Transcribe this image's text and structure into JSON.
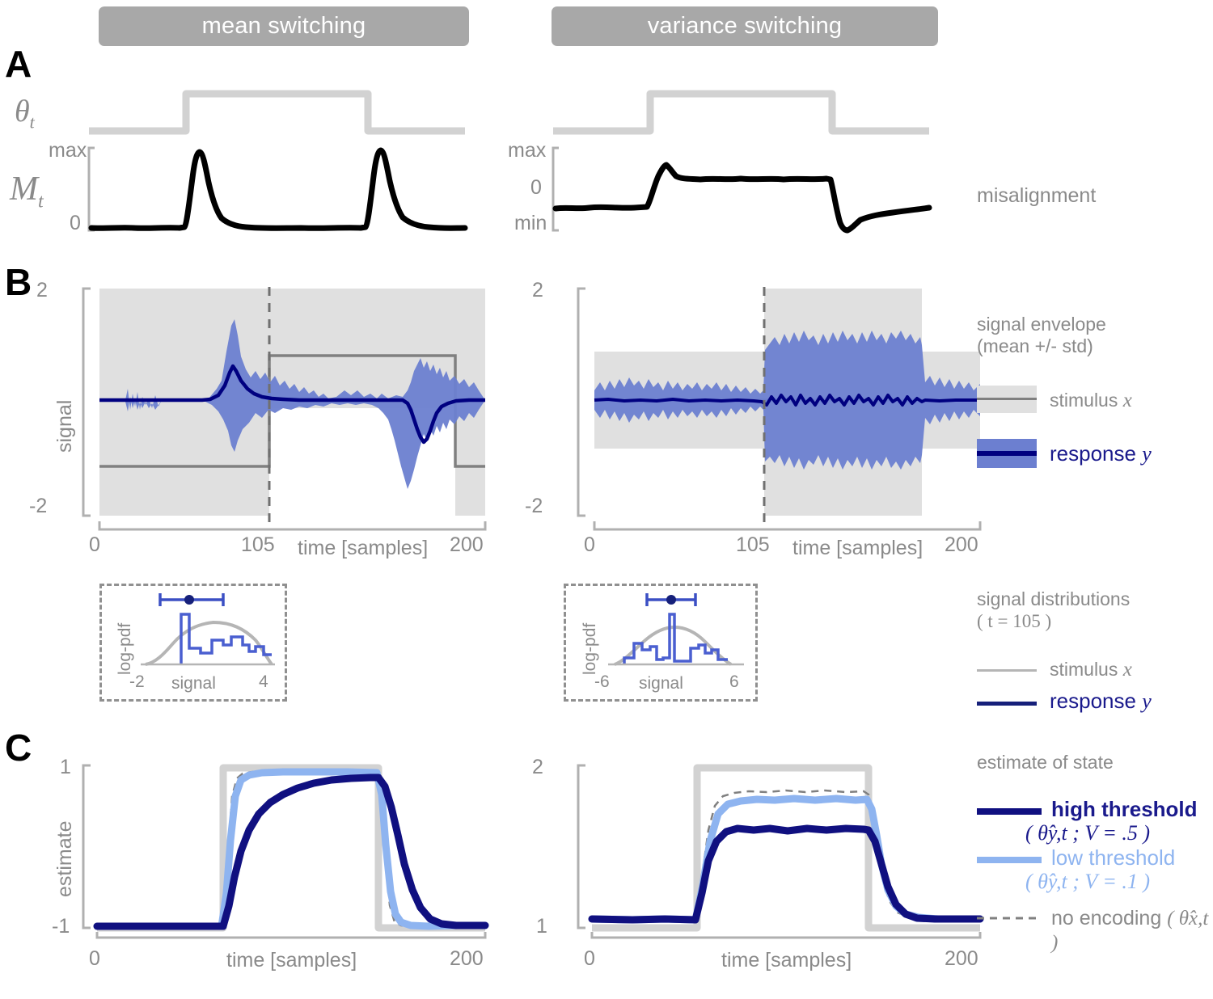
{
  "figure": {
    "columns": [
      {
        "id": "mean",
        "title": "mean switching"
      },
      {
        "id": "variance",
        "title": "variance switching"
      }
    ],
    "panels": [
      {
        "letter": "A"
      },
      {
        "letter": "B"
      },
      {
        "letter": "C"
      }
    ]
  },
  "panelA": {
    "state_label": "θ",
    "state_sub": "t",
    "misalign_label": "M",
    "misalign_sub": "t",
    "right_caption": "misalignment",
    "left": {
      "yticks": [
        "max",
        "0"
      ]
    },
    "right": {
      "yticks": [
        "max",
        "0",
        "min"
      ]
    }
  },
  "panelB": {
    "ylabel": "signal",
    "xlabel": "time [samples]",
    "xticks": [
      "0",
      "105",
      "200"
    ],
    "yticks": [
      "2",
      "-2"
    ],
    "legend": {
      "heading_line1": "signal envelope",
      "heading_line2": "(mean +/- std)",
      "items": [
        {
          "label_text": "stimulus ",
          "label_math": "x",
          "type": "band-grey"
        },
        {
          "label_text": "response ",
          "label_math": "y",
          "type": "band-blue"
        }
      ]
    },
    "inset": {
      "ylabel": "log-pdf",
      "xlabel": "signal",
      "left_xticks": [
        "-2",
        "4"
      ],
      "right_xticks": [
        "-6",
        "6"
      ]
    },
    "dist_legend": {
      "heading_line1": "signal distributions",
      "heading_line2": "( t = 105 )",
      "items": [
        {
          "label_text": "stimulus ",
          "label_math": "x",
          "type": "line-grey"
        },
        {
          "label_text": "response ",
          "label_math": "y",
          "type": "line-navy"
        }
      ]
    }
  },
  "panelC": {
    "ylabel": "estimate",
    "xlabel": "time [samples]",
    "xticks": [
      "0",
      "200"
    ],
    "left_yticks": [
      "1",
      "-1"
    ],
    "right_yticks": [
      "2",
      "1"
    ],
    "legend": {
      "heading": "estimate of state",
      "items": [
        {
          "label": "high threshold",
          "math": "( θ̂y,t ; V = .5 )",
          "type": "line-navy"
        },
        {
          "label": "low threshold",
          "math": "( θ̂y,t ; V = .1 )",
          "type": "line-lightblue"
        },
        {
          "label": "no encoding",
          "math": "( θ̂x,t )",
          "type": "line-dashed"
        }
      ]
    }
  },
  "colors": {
    "title_bar": "#a8a8a8",
    "state_trace": "#d2d2d2",
    "misalign_trace": "#000000",
    "stimulus_band": "#e0e0e0",
    "stimulus_line": "#808080",
    "response_band": "#6c7fd0",
    "response_line": "#000080",
    "high_threshold": "#101080",
    "low_threshold": "#8eb4f0",
    "no_encoding": "#808080",
    "axis": "#b0b0b0",
    "text": "#8a8a8a"
  },
  "chart_data": [
    {
      "type": "line",
      "id": "A-left-state",
      "title": "mean switching state",
      "xlabel": "",
      "ylabel": "θ_t",
      "xlim": [
        0,
        200
      ],
      "ylim": [
        0,
        1
      ],
      "grid": false,
      "x": [
        0,
        50,
        50,
        150,
        150,
        200
      ],
      "y": [
        0,
        0,
        1,
        1,
        0,
        0
      ]
    },
    {
      "type": "line",
      "id": "A-left-misalignment",
      "title": "mean switching misalignment",
      "xlabel": "",
      "ylabel": "M_t",
      "ytick_labels": [
        "max",
        "0"
      ],
      "xlim": [
        0,
        200
      ],
      "ylim": [
        0,
        1
      ],
      "grid": false,
      "description": "flat near 0 with two sharp peaks to max at the two switch times, each decaying over ~25 samples",
      "x": [
        0,
        10,
        20,
        30,
        40,
        48,
        50,
        52,
        55,
        58,
        62,
        66,
        70,
        76,
        84,
        92,
        100,
        110,
        120,
        130,
        140,
        146,
        148,
        150,
        152,
        155,
        158,
        162,
        166,
        170,
        176,
        184,
        192,
        200
      ],
      "y": [
        0.03,
        0.03,
        0.02,
        0.03,
        0.02,
        0.03,
        0.1,
        0.55,
        0.95,
        0.98,
        0.7,
        0.45,
        0.3,
        0.18,
        0.1,
        0.06,
        0.04,
        0.03,
        0.03,
        0.02,
        0.03,
        0.03,
        0.08,
        0.45,
        0.9,
        0.98,
        0.8,
        0.5,
        0.32,
        0.2,
        0.12,
        0.07,
        0.05,
        0.04
      ]
    },
    {
      "type": "line",
      "id": "A-right-state",
      "title": "variance switching state",
      "xlabel": "",
      "ylabel": "θ_t",
      "xlim": [
        0,
        200
      ],
      "ylim": [
        0,
        1
      ],
      "grid": false,
      "x": [
        0,
        50,
        50,
        150,
        150,
        200
      ],
      "y": [
        0,
        0,
        1,
        1,
        0,
        0
      ]
    },
    {
      "type": "line",
      "id": "A-right-misalignment",
      "title": "variance switching misalignment",
      "xlabel": "",
      "ylabel": "M_t",
      "ytick_labels": [
        "max",
        "0",
        "min"
      ],
      "xlim": [
        0,
        200
      ],
      "ylim": [
        -1,
        1
      ],
      "grid": false,
      "description": "negative baseline, steps up to positive plateau during the high-variance epoch with a small overshoot, then drops to min after the switch off and recovers",
      "x": [
        0,
        10,
        20,
        30,
        40,
        48,
        50,
        53,
        56,
        60,
        66,
        72,
        80,
        90,
        100,
        110,
        120,
        130,
        140,
        146,
        148,
        150,
        152,
        155,
        158,
        162,
        168,
        176,
        186,
        196,
        200
      ],
      "y": [
        -0.32,
        -0.31,
        -0.3,
        -0.32,
        -0.31,
        -0.3,
        -0.1,
        0.3,
        0.52,
        0.42,
        0.38,
        0.36,
        0.37,
        0.36,
        0.38,
        0.36,
        0.37,
        0.36,
        0.38,
        0.37,
        0.2,
        -0.4,
        -0.82,
        -0.92,
        -0.8,
        -0.55,
        -0.42,
        -0.37,
        -0.33,
        -0.3,
        -0.3
      ]
    },
    {
      "type": "area",
      "id": "B-left",
      "title": "mean switching signal envelope",
      "xlabel": "time [samples]",
      "ylabel": "signal",
      "xlim": [
        0,
        200
      ],
      "ylim": [
        -2,
        2
      ],
      "xtick_labels": [
        "0",
        "105",
        "200"
      ],
      "ytick_labels": [
        "2",
        "-2"
      ],
      "grid": false,
      "marker_x": 105,
      "series": [
        {
          "name": "stimulus x (mean)",
          "type": "step",
          "x": [
            0,
            100,
            100,
            150,
            150,
            200
          ],
          "y": [
            -0.85,
            -0.85,
            0.85,
            0.85,
            -0.85,
            -0.85
          ]
        },
        {
          "name": "stimulus x (std band)",
          "type": "band",
          "x": [
            0,
            100,
            100,
            150,
            150,
            200
          ],
          "upper": [
            1.15,
            1.15,
            2.0,
            2.0,
            1.15,
            1.15
          ],
          "lower": [
            -2.0,
            -2.0,
            -0.15,
            -0.15,
            -2.0,
            -2.0
          ]
        },
        {
          "name": "response y (mean)",
          "type": "line",
          "description": "flat at 0 except a positive transient peaking ~0.45 at t=105 and a negative transient dipping ~-0.55 at t=152"
        },
        {
          "name": "response y (std band)",
          "type": "band",
          "description": "narrow ripples around 0, widening to +1.45/-0.85 at t=105 and +0.55/-1.55 at t=152"
        }
      ]
    },
    {
      "type": "area",
      "id": "B-right",
      "title": "variance switching signal envelope",
      "xlabel": "time [samples]",
      "ylabel": "signal",
      "xlim": [
        0,
        200
      ],
      "ylim": [
        -2,
        2
      ],
      "xtick_labels": [
        "0",
        "105",
        "200"
      ],
      "ytick_labels": [
        "2",
        "-2"
      ],
      "grid": false,
      "marker_x": 105,
      "series": [
        {
          "name": "stimulus x (mean)",
          "type": "line",
          "y_const": 0.0
        },
        {
          "name": "stimulus x (std band)",
          "type": "band",
          "x": [
            0,
            100,
            100,
            150,
            150,
            200
          ],
          "upper": [
            0.85,
            0.85,
            2.0,
            2.0,
            0.85,
            0.85
          ],
          "lower": [
            -0.85,
            -0.85,
            -2.0,
            -2.0,
            -0.85,
            -0.85
          ]
        },
        {
          "name": "response y (mean)",
          "type": "line",
          "description": "noisy around 0, slightly larger jitter during the high-variance epoch"
        },
        {
          "name": "response y (std band)",
          "type": "band",
          "description": "band of +/-0.35 outside the epoch, expanding to roughly +/-1.3 during 100-150"
        }
      ]
    },
    {
      "type": "line",
      "id": "B-left-inset",
      "title": "signal distributions (t = 105), mean switching",
      "xlabel": "signal",
      "ylabel": "log-pdf",
      "xlim": [
        -2,
        4
      ],
      "xtick_labels": [
        "-2",
        "4"
      ],
      "grid": false,
      "series": [
        {
          "name": "stimulus x",
          "type": "smooth-curve",
          "description": "broad smooth inverted-parabola log-pdf centred near 1"
        },
        {
          "name": "response y",
          "type": "histogram-step",
          "description": "tall narrow spike just left of centre then a lower stepped shoulder extending right"
        }
      ],
      "errorbar": {
        "center": 0.9,
        "half_width": 1.2
      }
    },
    {
      "type": "line",
      "id": "B-right-inset",
      "title": "signal distributions (t = 105), variance switching",
      "xlabel": "signal",
      "ylabel": "log-pdf",
      "xlim": [
        -6,
        6
      ],
      "xtick_labels": [
        "-6",
        "6"
      ],
      "grid": false,
      "series": [
        {
          "name": "stimulus x",
          "type": "smooth-curve",
          "description": "broad smooth inverted-parabola log-pdf centred at 0"
        },
        {
          "name": "response y",
          "type": "histogram-step",
          "description": "tall narrow spike at 0 with low symmetric stepped shoulders on both sides"
        }
      ],
      "errorbar": {
        "center": 0.0,
        "half_width": 1.3
      }
    },
    {
      "type": "line",
      "id": "C-left",
      "title": "estimate of state, mean switching",
      "xlabel": "time [samples]",
      "ylabel": "estimate",
      "xlim": [
        0,
        200
      ],
      "ylim": [
        -1,
        1
      ],
      "xtick_labels": [
        "0",
        "200"
      ],
      "ytick_labels": [
        "1",
        "-1"
      ],
      "grid": false,
      "series": [
        {
          "name": "true state",
          "color": "#d2d2d2",
          "x": [
            0,
            75,
            75,
            150,
            150,
            200
          ],
          "y": [
            -1,
            -1,
            1,
            1,
            -1,
            -1
          ]
        },
        {
          "name": "high threshold",
          "color": "#101080",
          "description": "sigmoidal rise starting at t=75 reaching 0.93 by t=110, slow decay after t=150 back to -1 by t=185"
        },
        {
          "name": "low threshold",
          "color": "#8eb4f0",
          "description": "fast rise at t=75 to 0.97 by t=85, fast fall at t=150 to -0.95 by t=160"
        },
        {
          "name": "no encoding",
          "color": "#808080",
          "style": "dashed",
          "description": "near-ideal step following the true state closely"
        }
      ]
    },
    {
      "type": "line",
      "id": "C-right",
      "title": "estimate of state, variance switching",
      "xlabel": "time [samples]",
      "ylabel": "estimate",
      "xlim": [
        0,
        200
      ],
      "ylim": [
        1,
        2
      ],
      "xtick_labels": [
        "0",
        "200"
      ],
      "ytick_labels": [
        "2",
        "1"
      ],
      "grid": false,
      "series": [
        {
          "name": "true state",
          "color": "#d2d2d2",
          "x": [
            0,
            75,
            75,
            150,
            150,
            200
          ],
          "y": [
            1,
            1,
            2,
            2,
            1,
            1
          ]
        },
        {
          "name": "high threshold",
          "color": "#101080",
          "description": "rises to a plateau near 1.60 during the epoch, returns to ~1.10"
        },
        {
          "name": "low threshold",
          "color": "#8eb4f0",
          "description": "rises to a plateau near 1.78 during the epoch, returns to ~1.08"
        },
        {
          "name": "no encoding",
          "color": "#808080",
          "style": "dashed",
          "description": "plateau near 1.83, slightly above the low threshold trace"
        }
      ]
    }
  ]
}
